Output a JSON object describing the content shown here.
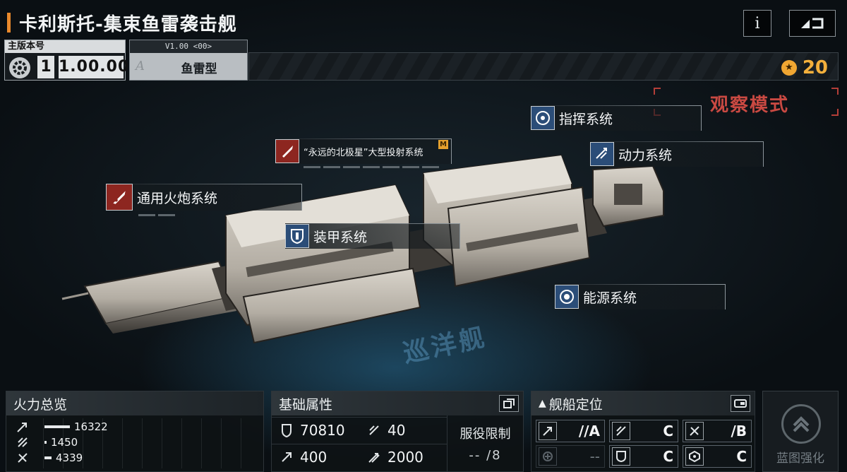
{
  "header": {
    "title": "卡利斯托-集束鱼雷袭击舰",
    "info_label": "i"
  },
  "version": {
    "label": "主版本号",
    "major": "1",
    "minor": "1.00.00",
    "variant_code": "V1.00 <00>",
    "variant_grade": "A",
    "variant_type": "鱼雷型"
  },
  "rank": {
    "value": "20"
  },
  "mode": {
    "label": "观察模式"
  },
  "watermark": "巡洋舰",
  "systems": [
    {
      "label": "指挥系统",
      "icon": "command-icon"
    },
    {
      "label": "动力系统",
      "icon": "engine-icon"
    },
    {
      "label": "“永远的北极星”大型投射系统",
      "icon": "missile-icon",
      "tag": "M"
    },
    {
      "label": "通用火炮系统",
      "icon": "cannon-icon"
    },
    {
      "label": "装甲系统",
      "icon": "armor-icon"
    },
    {
      "label": "能源系统",
      "icon": "energy-icon"
    }
  ],
  "firepower": {
    "title": "火力总览",
    "rows": [
      {
        "icon": "anti-ship-icon",
        "value": "16322",
        "ratio": 1.0
      },
      {
        "icon": "anti-aircraft-icon",
        "value": "1450",
        "ratio": 0.09
      },
      {
        "icon": "siege-icon",
        "value": "4339",
        "ratio": 0.27
      }
    ]
  },
  "base_attributes": {
    "title": "基础属性",
    "hp": "70810",
    "armor": "40",
    "speed": "400",
    "warp": "2000",
    "service_limit_label": "服役限制",
    "service_limit_value": "-- /8"
  },
  "positioning": {
    "title": "舰船定位",
    "cells": [
      {
        "icon": "anti-ship-icon",
        "grade": "//A"
      },
      {
        "icon": "anti-aircraft-icon",
        "grade": "C"
      },
      {
        "icon": "siege-icon",
        "grade": "/B"
      },
      {
        "icon": "support-icon",
        "grade": "--"
      },
      {
        "icon": "defense-icon",
        "grade": "C"
      },
      {
        "icon": "utility-icon",
        "grade": "C"
      }
    ]
  },
  "enhance": {
    "label": "蓝图强化"
  },
  "colors": {
    "accent_orange": "#e8892c",
    "rank_gold": "#f4b03c",
    "observe_red": "#c94942",
    "system_red": "#8d2620",
    "system_blue": "#2b4d78"
  }
}
